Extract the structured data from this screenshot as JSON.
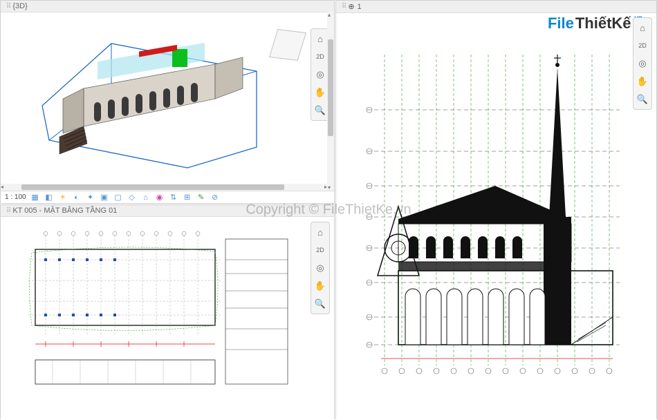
{
  "watermark": {
    "brand_part1": "File",
    "brand_part2": "ThiếtKế",
    "brand_tld": ".vn",
    "copyright": "Copyright © FileThietKe.vn"
  },
  "pane_3d": {
    "title": "{3D}",
    "scale": "1 : 100",
    "tools": [
      "home-icon",
      "2d-icon",
      "steering-icon",
      "hand-icon",
      "zoom-icon"
    ],
    "status_icons": [
      "model-graphics-icon",
      "sun-path-icon",
      "shadows-icon",
      "render-icon",
      "crop-icon",
      "crop-region-icon",
      "hide-icon",
      "isolate-icon",
      "reveal-icon",
      "analytical-icon",
      "lock-icon",
      "constrain-icon"
    ]
  },
  "pane_plan": {
    "title": "KT 005 - MẶT BẰNG TẦNG 01",
    "tools": [
      "home-icon",
      "2d-icon",
      "steering-icon",
      "hand-icon",
      "zoom-icon"
    ]
  },
  "pane_elev": {
    "title": "1",
    "tools": [
      "home-icon",
      "2d-icon",
      "steering-icon",
      "hand-icon",
      "zoom-icon"
    ],
    "small_circle": "⊕"
  }
}
